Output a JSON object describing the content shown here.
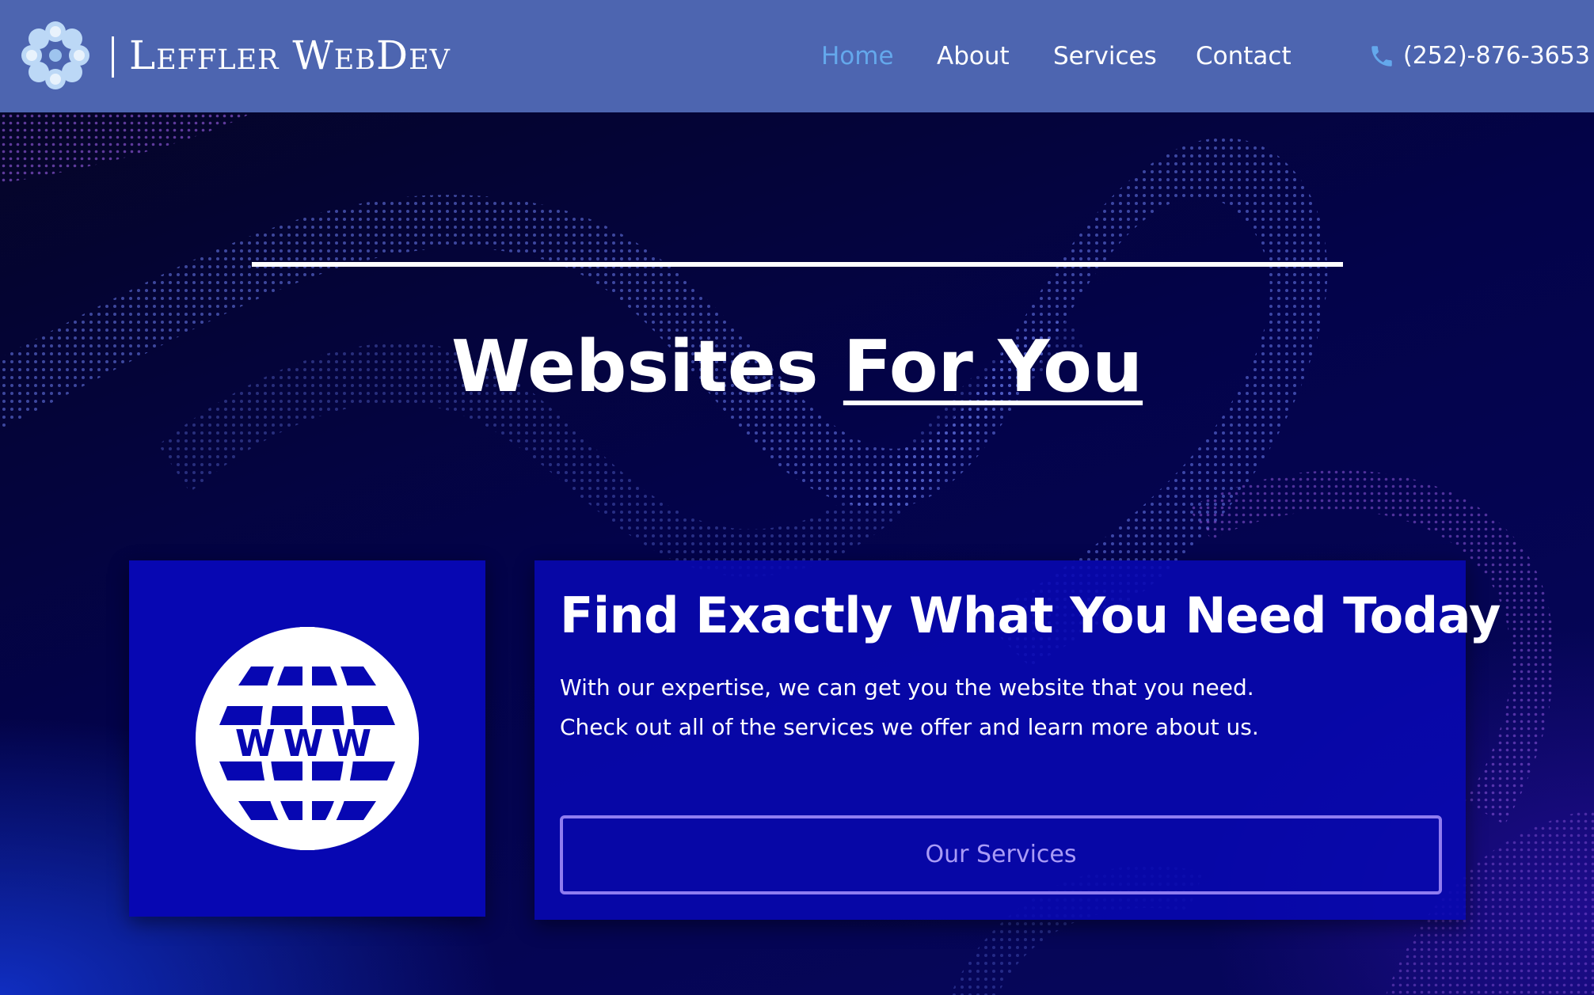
{
  "brand": {
    "name": "Leffler WebDev",
    "logo_icon": "flower-logo-icon"
  },
  "nav": {
    "items": [
      {
        "label": "Home",
        "active": true
      },
      {
        "label": "About",
        "active": false
      },
      {
        "label": "Services",
        "active": false
      },
      {
        "label": "Contact",
        "active": false
      }
    ]
  },
  "contact": {
    "phone": "(252)-876-3653",
    "icon": "phone-icon"
  },
  "hero": {
    "headline_plain": "Websites ",
    "headline_emphasis": "For You"
  },
  "feature": {
    "icon": "www-globe-icon",
    "title": "Find Exactly What You Need Today",
    "body": "With our expertise, we can get you the website that you need. Check out all of the services we offer and learn more about us.",
    "button_label": "Our Services"
  },
  "colors": {
    "header_bg": "#4d65b0",
    "nav_active": "#64a8ec",
    "card_bg": "#0707b2",
    "button_border": "#8f7cf0",
    "hero_bg": "#03034a"
  }
}
